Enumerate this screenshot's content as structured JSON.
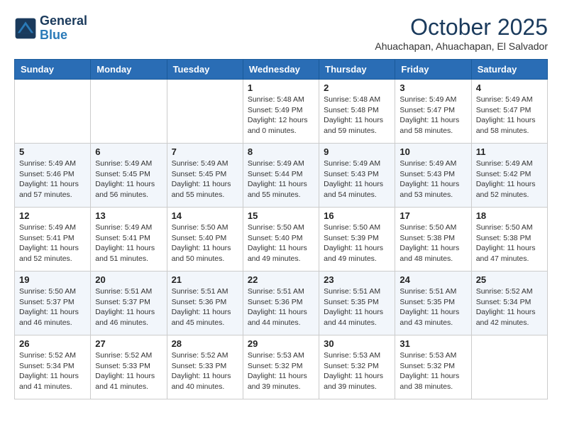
{
  "header": {
    "logo_line1": "General",
    "logo_line2": "Blue",
    "month_year": "October 2025",
    "location": "Ahuachapan, Ahuachapan, El Salvador"
  },
  "weekdays": [
    "Sunday",
    "Monday",
    "Tuesday",
    "Wednesday",
    "Thursday",
    "Friday",
    "Saturday"
  ],
  "weeks": [
    [
      {
        "day": "",
        "info": ""
      },
      {
        "day": "",
        "info": ""
      },
      {
        "day": "",
        "info": ""
      },
      {
        "day": "1",
        "info": "Sunrise: 5:48 AM\nSunset: 5:49 PM\nDaylight: 12 hours\nand 0 minutes."
      },
      {
        "day": "2",
        "info": "Sunrise: 5:48 AM\nSunset: 5:48 PM\nDaylight: 11 hours\nand 59 minutes."
      },
      {
        "day": "3",
        "info": "Sunrise: 5:49 AM\nSunset: 5:47 PM\nDaylight: 11 hours\nand 58 minutes."
      },
      {
        "day": "4",
        "info": "Sunrise: 5:49 AM\nSunset: 5:47 PM\nDaylight: 11 hours\nand 58 minutes."
      }
    ],
    [
      {
        "day": "5",
        "info": "Sunrise: 5:49 AM\nSunset: 5:46 PM\nDaylight: 11 hours\nand 57 minutes."
      },
      {
        "day": "6",
        "info": "Sunrise: 5:49 AM\nSunset: 5:45 PM\nDaylight: 11 hours\nand 56 minutes."
      },
      {
        "day": "7",
        "info": "Sunrise: 5:49 AM\nSunset: 5:45 PM\nDaylight: 11 hours\nand 55 minutes."
      },
      {
        "day": "8",
        "info": "Sunrise: 5:49 AM\nSunset: 5:44 PM\nDaylight: 11 hours\nand 55 minutes."
      },
      {
        "day": "9",
        "info": "Sunrise: 5:49 AM\nSunset: 5:43 PM\nDaylight: 11 hours\nand 54 minutes."
      },
      {
        "day": "10",
        "info": "Sunrise: 5:49 AM\nSunset: 5:43 PM\nDaylight: 11 hours\nand 53 minutes."
      },
      {
        "day": "11",
        "info": "Sunrise: 5:49 AM\nSunset: 5:42 PM\nDaylight: 11 hours\nand 52 minutes."
      }
    ],
    [
      {
        "day": "12",
        "info": "Sunrise: 5:49 AM\nSunset: 5:41 PM\nDaylight: 11 hours\nand 52 minutes."
      },
      {
        "day": "13",
        "info": "Sunrise: 5:49 AM\nSunset: 5:41 PM\nDaylight: 11 hours\nand 51 minutes."
      },
      {
        "day": "14",
        "info": "Sunrise: 5:50 AM\nSunset: 5:40 PM\nDaylight: 11 hours\nand 50 minutes."
      },
      {
        "day": "15",
        "info": "Sunrise: 5:50 AM\nSunset: 5:40 PM\nDaylight: 11 hours\nand 49 minutes."
      },
      {
        "day": "16",
        "info": "Sunrise: 5:50 AM\nSunset: 5:39 PM\nDaylight: 11 hours\nand 49 minutes."
      },
      {
        "day": "17",
        "info": "Sunrise: 5:50 AM\nSunset: 5:38 PM\nDaylight: 11 hours\nand 48 minutes."
      },
      {
        "day": "18",
        "info": "Sunrise: 5:50 AM\nSunset: 5:38 PM\nDaylight: 11 hours\nand 47 minutes."
      }
    ],
    [
      {
        "day": "19",
        "info": "Sunrise: 5:50 AM\nSunset: 5:37 PM\nDaylight: 11 hours\nand 46 minutes."
      },
      {
        "day": "20",
        "info": "Sunrise: 5:51 AM\nSunset: 5:37 PM\nDaylight: 11 hours\nand 46 minutes."
      },
      {
        "day": "21",
        "info": "Sunrise: 5:51 AM\nSunset: 5:36 PM\nDaylight: 11 hours\nand 45 minutes."
      },
      {
        "day": "22",
        "info": "Sunrise: 5:51 AM\nSunset: 5:36 PM\nDaylight: 11 hours\nand 44 minutes."
      },
      {
        "day": "23",
        "info": "Sunrise: 5:51 AM\nSunset: 5:35 PM\nDaylight: 11 hours\nand 44 minutes."
      },
      {
        "day": "24",
        "info": "Sunrise: 5:51 AM\nSunset: 5:35 PM\nDaylight: 11 hours\nand 43 minutes."
      },
      {
        "day": "25",
        "info": "Sunrise: 5:52 AM\nSunset: 5:34 PM\nDaylight: 11 hours\nand 42 minutes."
      }
    ],
    [
      {
        "day": "26",
        "info": "Sunrise: 5:52 AM\nSunset: 5:34 PM\nDaylight: 11 hours\nand 41 minutes."
      },
      {
        "day": "27",
        "info": "Sunrise: 5:52 AM\nSunset: 5:33 PM\nDaylight: 11 hours\nand 41 minutes."
      },
      {
        "day": "28",
        "info": "Sunrise: 5:52 AM\nSunset: 5:33 PM\nDaylight: 11 hours\nand 40 minutes."
      },
      {
        "day": "29",
        "info": "Sunrise: 5:53 AM\nSunset: 5:32 PM\nDaylight: 11 hours\nand 39 minutes."
      },
      {
        "day": "30",
        "info": "Sunrise: 5:53 AM\nSunset: 5:32 PM\nDaylight: 11 hours\nand 39 minutes."
      },
      {
        "day": "31",
        "info": "Sunrise: 5:53 AM\nSunset: 5:32 PM\nDaylight: 11 hours\nand 38 minutes."
      },
      {
        "day": "",
        "info": ""
      }
    ]
  ]
}
